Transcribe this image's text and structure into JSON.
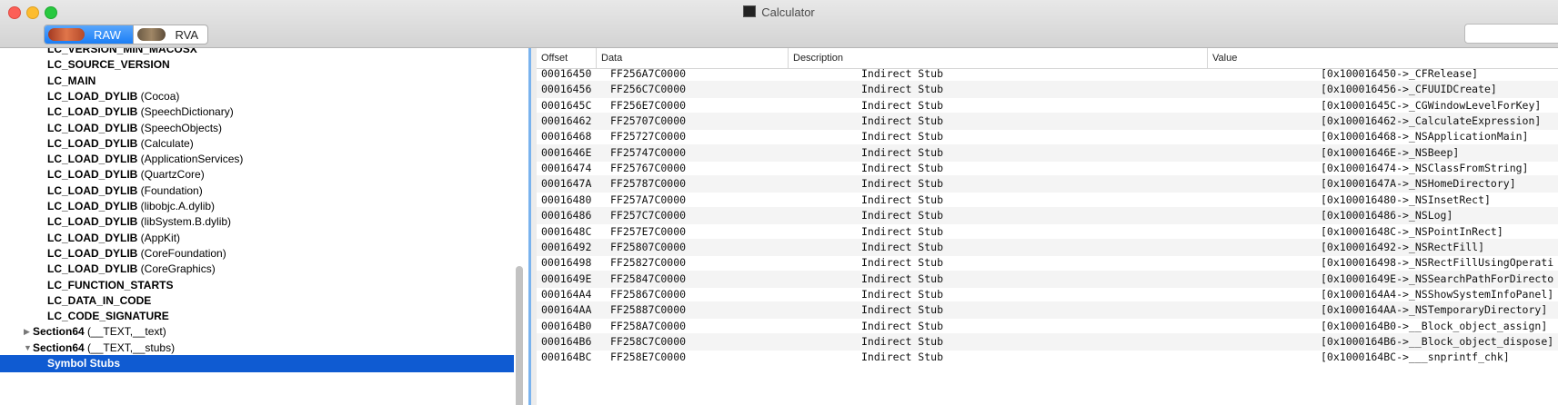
{
  "window": {
    "title": "Calculator"
  },
  "toolbar": {
    "segments": [
      {
        "label": "RAW",
        "icon": "raw-icon"
      },
      {
        "label": "RVA",
        "icon": "rva-icon"
      }
    ],
    "search": {
      "value": ""
    }
  },
  "tree": {
    "items": [
      {
        "label": "LC_VERSION_MIN_MACOSX",
        "paren": ""
      },
      {
        "label": "LC_SOURCE_VERSION",
        "paren": ""
      },
      {
        "label": "LC_MAIN",
        "paren": ""
      },
      {
        "label": "LC_LOAD_DYLIB",
        "paren": " (Cocoa)"
      },
      {
        "label": "LC_LOAD_DYLIB",
        "paren": " (SpeechDictionary)"
      },
      {
        "label": "LC_LOAD_DYLIB",
        "paren": " (SpeechObjects)"
      },
      {
        "label": "LC_LOAD_DYLIB",
        "paren": " (Calculate)"
      },
      {
        "label": "LC_LOAD_DYLIB",
        "paren": " (ApplicationServices)"
      },
      {
        "label": "LC_LOAD_DYLIB",
        "paren": " (QuartzCore)"
      },
      {
        "label": "LC_LOAD_DYLIB",
        "paren": " (Foundation)"
      },
      {
        "label": "LC_LOAD_DYLIB",
        "paren": " (libobjc.A.dylib)"
      },
      {
        "label": "LC_LOAD_DYLIB",
        "paren": " (libSystem.B.dylib)"
      },
      {
        "label": "LC_LOAD_DYLIB",
        "paren": " (AppKit)"
      },
      {
        "label": "LC_LOAD_DYLIB",
        "paren": " (CoreFoundation)"
      },
      {
        "label": "LC_LOAD_DYLIB",
        "paren": " (CoreGraphics)"
      },
      {
        "label": "LC_FUNCTION_STARTS",
        "paren": ""
      },
      {
        "label": "LC_DATA_IN_CODE",
        "paren": ""
      },
      {
        "label": "LC_CODE_SIGNATURE",
        "paren": ""
      }
    ],
    "sections": [
      {
        "label": "Section64",
        "paren": " (__TEXT,__text)",
        "expanded": false
      },
      {
        "label": "Section64",
        "paren": " (__TEXT,__stubs)",
        "expanded": true
      }
    ],
    "selected": {
      "label": "Symbol Stubs"
    }
  },
  "table": {
    "headers": {
      "offset": "Offset",
      "data": "Data",
      "description": "Description",
      "value": "Value"
    },
    "rows": [
      {
        "offset": "00016450",
        "data": "FF256A7C0000",
        "description": "Indirect Stub",
        "value": "[0x100016450->_CFRelease]"
      },
      {
        "offset": "00016456",
        "data": "FF256C7C0000",
        "description": "Indirect Stub",
        "value": "[0x100016456->_CFUUIDCreate]"
      },
      {
        "offset": "0001645C",
        "data": "FF256E7C0000",
        "description": "Indirect Stub",
        "value": "[0x10001645C->_CGWindowLevelForKey]"
      },
      {
        "offset": "00016462",
        "data": "FF25707C0000",
        "description": "Indirect Stub",
        "value": "[0x100016462->_CalculateExpression]"
      },
      {
        "offset": "00016468",
        "data": "FF25727C0000",
        "description": "Indirect Stub",
        "value": "[0x100016468->_NSApplicationMain]"
      },
      {
        "offset": "0001646E",
        "data": "FF25747C0000",
        "description": "Indirect Stub",
        "value": "[0x10001646E->_NSBeep]"
      },
      {
        "offset": "00016474",
        "data": "FF25767C0000",
        "description": "Indirect Stub",
        "value": "[0x100016474->_NSClassFromString]"
      },
      {
        "offset": "0001647A",
        "data": "FF25787C0000",
        "description": "Indirect Stub",
        "value": "[0x10001647A->_NSHomeDirectory]"
      },
      {
        "offset": "00016480",
        "data": "FF257A7C0000",
        "description": "Indirect Stub",
        "value": "[0x100016480->_NSInsetRect]"
      },
      {
        "offset": "00016486",
        "data": "FF257C7C0000",
        "description": "Indirect Stub",
        "value": "[0x100016486->_NSLog]"
      },
      {
        "offset": "0001648C",
        "data": "FF257E7C0000",
        "description": "Indirect Stub",
        "value": "[0x10001648C->_NSPointInRect]"
      },
      {
        "offset": "00016492",
        "data": "FF25807C0000",
        "description": "Indirect Stub",
        "value": "[0x100016492->_NSRectFill]"
      },
      {
        "offset": "00016498",
        "data": "FF25827C0000",
        "description": "Indirect Stub",
        "value": "[0x100016498->_NSRectFillUsingOperati"
      },
      {
        "offset": "0001649E",
        "data": "FF25847C0000",
        "description": "Indirect Stub",
        "value": "[0x10001649E->_NSSearchPathForDirecto"
      },
      {
        "offset": "000164A4",
        "data": "FF25867C0000",
        "description": "Indirect Stub",
        "value": "[0x1000164A4->_NSShowSystemInfoPanel]"
      },
      {
        "offset": "000164AA",
        "data": "FF25887C0000",
        "description": "Indirect Stub",
        "value": "[0x1000164AA->_NSTemporaryDirectory]"
      },
      {
        "offset": "000164B0",
        "data": "FF258A7C0000",
        "description": "Indirect Stub",
        "value": "[0x1000164B0->__Block_object_assign]"
      },
      {
        "offset": "000164B6",
        "data": "FF258C7C0000",
        "description": "Indirect Stub",
        "value": "[0x1000164B6->__Block_object_dispose]"
      },
      {
        "offset": "000164BC",
        "data": "FF258E7C0000",
        "description": "Indirect Stub",
        "value": "[0x1000164BC->___snprintf_chk]"
      }
    ]
  }
}
